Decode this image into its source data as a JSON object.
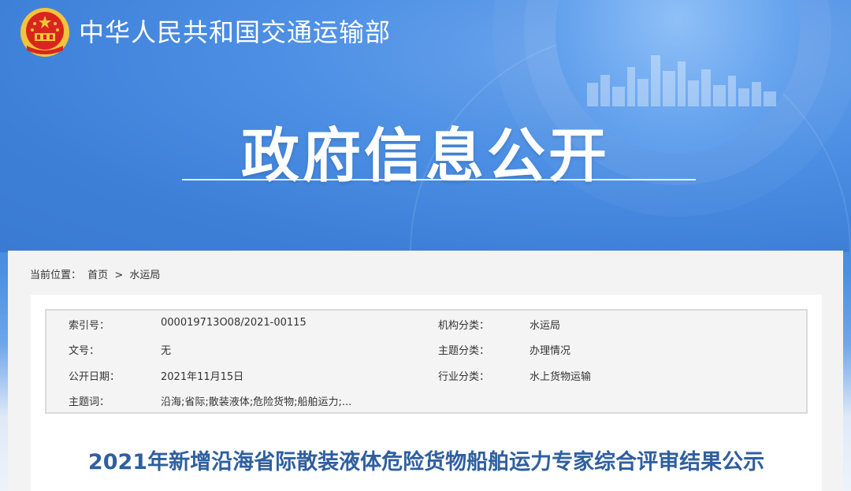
{
  "header": {
    "ministry_name": "中华人民共和国交通运输部",
    "section_title": "政府信息公开"
  },
  "breadcrumb": {
    "prefix": "当前位置：",
    "home": "首页",
    "separator": ">",
    "current": "水运局"
  },
  "meta": {
    "index_label": "索引号：",
    "index_value": "000019713O08/2021-00115",
    "org_label": "机构分类：",
    "org_value": "水运局",
    "doc_label": "文号：",
    "doc_value": "无",
    "topic_label": "主题分类：",
    "topic_value": "办理情况",
    "date_label": "公开日期：",
    "date_value": "2021年11月15日",
    "industry_label": "行业分类：",
    "industry_value": "水上货物运输",
    "keywords_label": "主题词：",
    "keywords_value": "沿海;省际;散装液体;危险货物;船舶运力;..."
  },
  "article": {
    "title": "2021年新增沿海省际散装液体危险货物船舶运力专家综合评审结果公示"
  },
  "colors": {
    "banner_blue": "#3d7fd7",
    "title_blue": "#2f5f9e",
    "emblem_red": "#d8261d",
    "emblem_gold": "#f3c43a"
  }
}
